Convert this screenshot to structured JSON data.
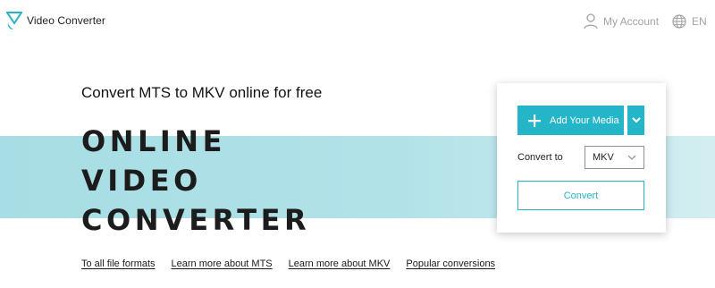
{
  "header": {
    "brand": "Video Converter",
    "account_label": "My Account",
    "lang_label": "EN"
  },
  "hero": {
    "subtitle": "Convert MTS to MKV online for free",
    "title_lines": [
      "ONLINE",
      "VIDEO",
      "CONVERTER"
    ]
  },
  "converter": {
    "add_media_label": "Add Your Media",
    "convert_to_label": "Convert to",
    "selected_format": "MKV",
    "convert_button": "Convert"
  },
  "links": [
    "To all file formats",
    "Learn more about MTS",
    "Learn more about MKV",
    "Popular conversions"
  ],
  "colors": {
    "accent": "#25b5c8",
    "band": "#a7dde4"
  },
  "icons": {
    "logo": "logo-icon",
    "account": "user-icon",
    "language": "globe-icon",
    "add": "plus-icon",
    "dropdown": "chevron-down-icon"
  }
}
